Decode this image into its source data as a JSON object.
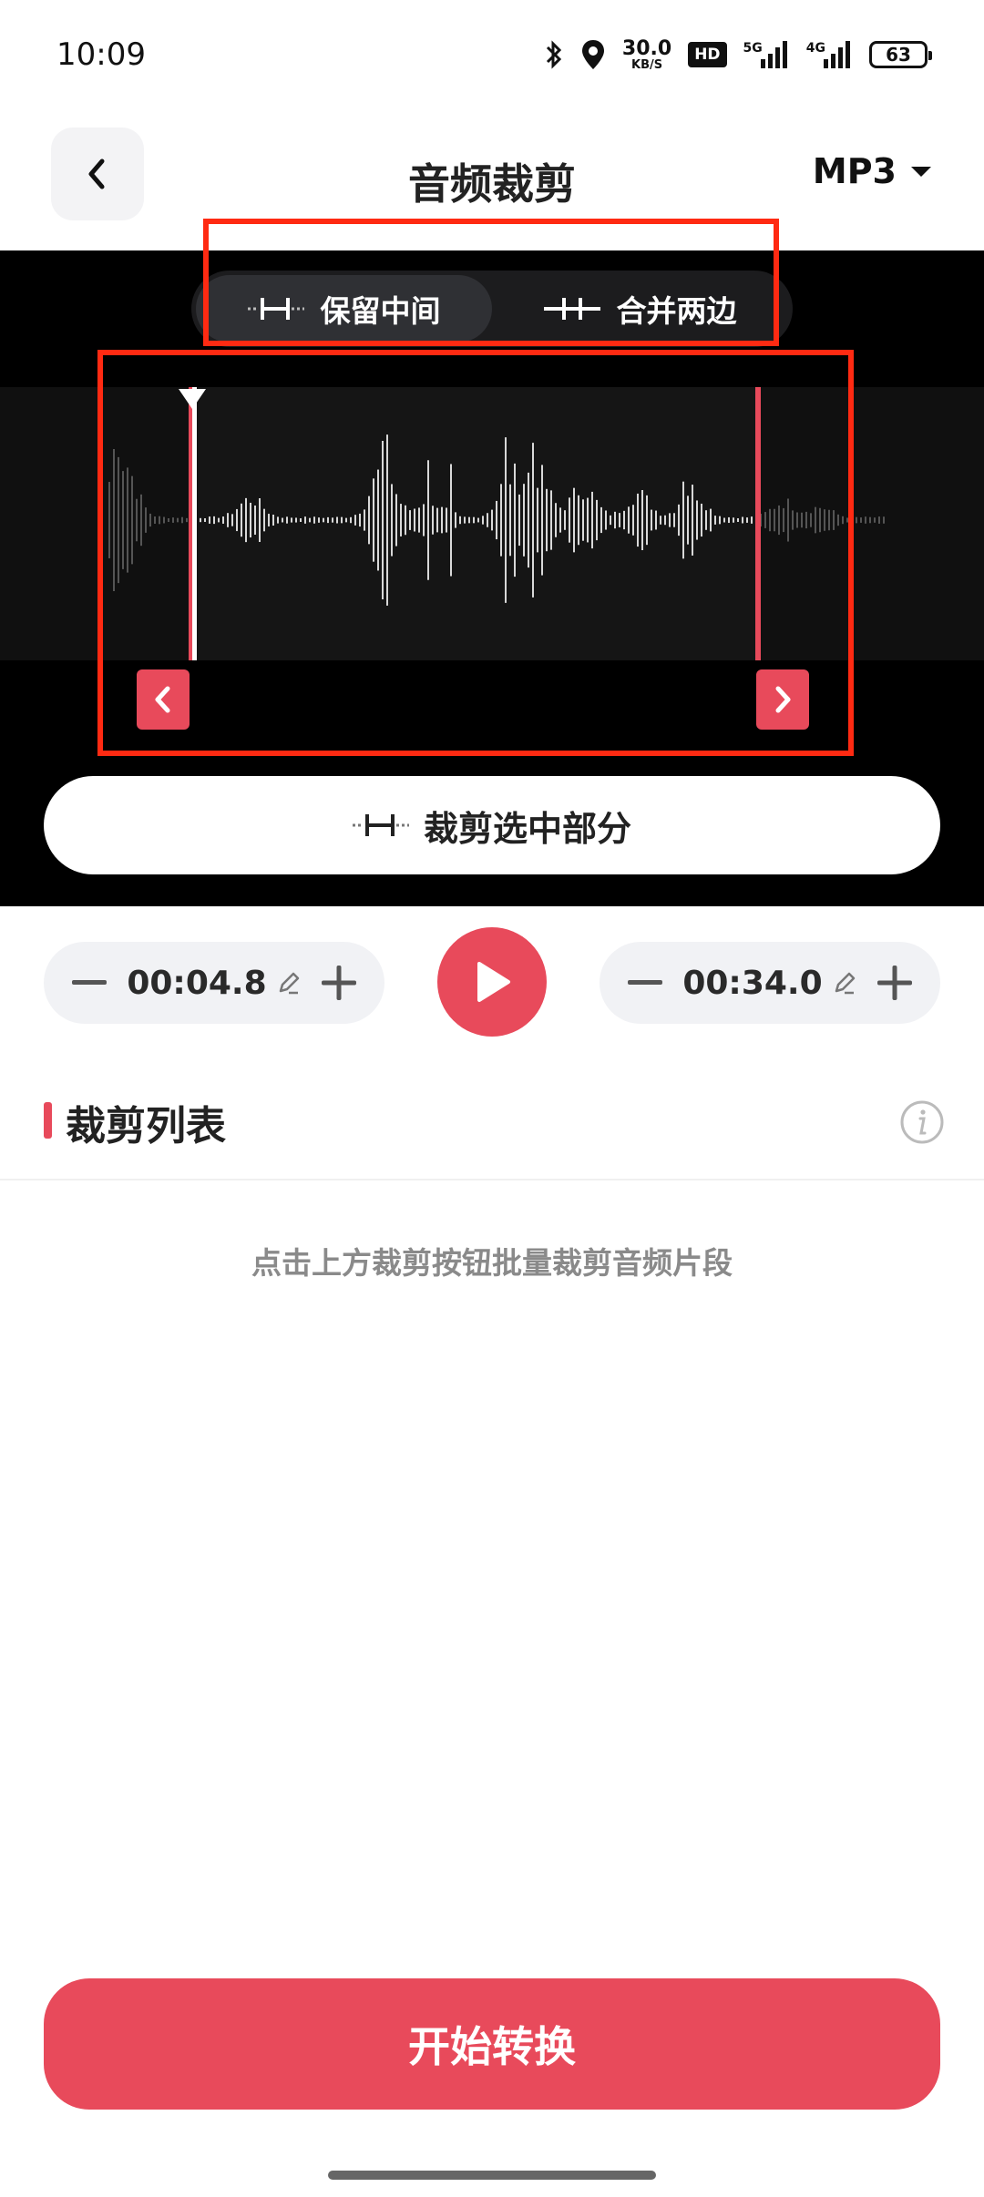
{
  "status": {
    "time": "10:09",
    "net_speed_value": "30.0",
    "net_speed_unit": "KB/S",
    "hd": "HD",
    "sig1_label": "5G",
    "sig2_label": "4G",
    "battery": "63"
  },
  "header": {
    "title": "音频裁剪",
    "format": "MP3"
  },
  "editor": {
    "modes": [
      {
        "label": "保留中间",
        "active": true
      },
      {
        "label": "合并两边",
        "active": false
      }
    ],
    "crop_label": "裁剪选中部分"
  },
  "time": {
    "start": "00:04.8",
    "end": "00:34.0"
  },
  "list": {
    "title": "裁剪列表",
    "empty_hint": "点击上方裁剪按钮批量裁剪音频片段"
  },
  "convert_label": "开始转换",
  "colors": {
    "accent": "#e84a5b",
    "highlight": "#ff2a12",
    "editor_bg": "#000000"
  },
  "icons": {
    "back": "chevron-left-icon",
    "dropdown": "caret-down-icon",
    "play": "play-icon",
    "info": "info-icon",
    "edit": "pencil-icon"
  }
}
